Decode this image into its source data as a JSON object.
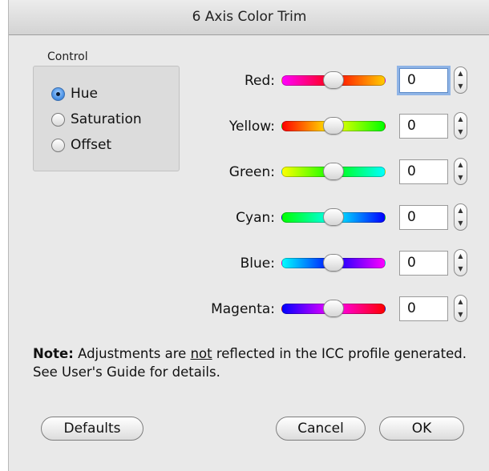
{
  "window": {
    "title": "6 Axis Color Trim"
  },
  "control": {
    "label": "Control",
    "options": [
      {
        "label": "Hue",
        "checked": true
      },
      {
        "label": "Saturation",
        "checked": false
      },
      {
        "label": "Offset",
        "checked": false
      }
    ]
  },
  "sliders": [
    {
      "label": "Red:",
      "value": "0",
      "position": 0.5,
      "gradient": [
        "#ff00ff",
        "#ff0000",
        "#ffcc00"
      ]
    },
    {
      "label": "Yellow:",
      "value": "0",
      "position": 0.5,
      "gradient": [
        "#ff0000",
        "#ffff00",
        "#00ff00"
      ]
    },
    {
      "label": "Green:",
      "value": "0",
      "position": 0.5,
      "gradient": [
        "#ffff00",
        "#00ff00",
        "#00ffff"
      ]
    },
    {
      "label": "Cyan:",
      "value": "0",
      "position": 0.5,
      "gradient": [
        "#00ff00",
        "#00ffff",
        "#0000ff"
      ]
    },
    {
      "label": "Blue:",
      "value": "0",
      "position": 0.5,
      "gradient": [
        "#00ffff",
        "#0000ff",
        "#ff00ff"
      ]
    },
    {
      "label": "Magenta:",
      "value": "0",
      "position": 0.5,
      "gradient": [
        "#0000ff",
        "#ff00ff",
        "#ff0000"
      ]
    }
  ],
  "note": {
    "bold": "Note:",
    "text_before": " Adjustments are ",
    "underlined": "not",
    "text_after": " reflected in the ICC profile generated. See User's Guide for details."
  },
  "buttons": {
    "defaults": "Defaults",
    "cancel": "Cancel",
    "ok": "OK"
  },
  "stepper_icons": {
    "up": "chevron-up-icon",
    "down": "chevron-down-icon"
  },
  "colors": {
    "focus_ring": "#8fb4e6",
    "radio_selected": "#4d93e6"
  }
}
